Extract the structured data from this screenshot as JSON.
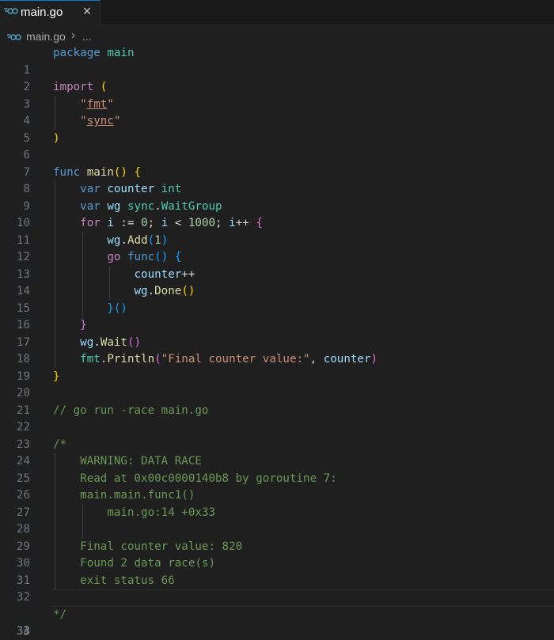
{
  "tab": {
    "label": "main.go",
    "close_icon": "×"
  },
  "breadcrumb": {
    "file": "main.go",
    "separator": "›",
    "more": "..."
  },
  "editor": {
    "line_numbers": [
      "1",
      "2",
      "3",
      "4",
      "5",
      "6",
      "7",
      "8",
      "9",
      "10",
      "11",
      "12",
      "13",
      "14",
      "15",
      "16",
      "17",
      "18",
      "19",
      "20",
      "21",
      "22",
      "23",
      "24",
      "25",
      "26",
      "27",
      "28",
      "29",
      "30",
      "31",
      "32",
      "33",
      "34"
    ],
    "active_line": 33,
    "code": {
      "l1_kw": "package",
      "l1_name": "main",
      "l3_kw": "import",
      "l3_paren": "(",
      "l4_q1": "\"",
      "l4_pkg": "fmt",
      "l4_q2": "\"",
      "l5_q1": "\"",
      "l5_pkg": "sync",
      "l5_q2": "\"",
      "l6_paren": ")",
      "l8_kw": "func",
      "l8_name": "main",
      "l8_parens": "()",
      "l8_brace": "{",
      "l9_kw": "var",
      "l9_name": "counter",
      "l9_type": "int",
      "l10_kw": "var",
      "l10_name": "wg",
      "l10_pkg": "sync",
      "l10_dot": ".",
      "l10_type": "WaitGroup",
      "l11_kw": "for",
      "l11_i": "i",
      "l11_op": " := ",
      "l11_zero": "0",
      "l11_semi1": "; ",
      "l11_i2": "i",
      "l11_lt": " < ",
      "l11_n": "1000",
      "l11_semi2": "; ",
      "l11_i3": "i",
      "l11_inc": "++",
      "l11_brace": "{",
      "l12_obj": "wg",
      "l12_dot": ".",
      "l12_fn": "Add",
      "l12_p1": "(",
      "l12_num": "1",
      "l12_p2": ")",
      "l13_kw": "go",
      "l13_fn": "func",
      "l13_parens": "()",
      "l13_brace": "{",
      "l14_var": "counter",
      "l14_op": "++",
      "l15_obj": "wg",
      "l15_dot": ".",
      "l15_fn": "Done",
      "l15_parens": "()",
      "l16_brace": "}",
      "l16_parens": "()",
      "l17_brace": "}",
      "l18_obj": "wg",
      "l18_dot": ".",
      "l18_fn": "Wait",
      "l18_parens": "()",
      "l19_pkg": "fmt",
      "l19_dot": ".",
      "l19_fn": "Println",
      "l19_p1": "(",
      "l19_str": "\"Final counter value:\"",
      "l19_comma": ", ",
      "l19_var": "counter",
      "l19_p2": ")",
      "l20_brace": "}",
      "l22_comment": "// go run -race main.go",
      "l24_comment": "/*",
      "l25_comment": "WARNING: DATA RACE",
      "l26_comment": "Read at 0x00c0000140b8 by goroutine 7:",
      "l27_comment": "main.main.func1()",
      "l28_comment": "main.go:14 +0x33",
      "l30_comment": "Final counter value: 820",
      "l31_comment": "Found 2 data race(s)",
      "l32_comment": "exit status 66",
      "l34_comment": "*/"
    }
  },
  "colors": {
    "background": "#1f1f1f",
    "keyword": "#569cd6",
    "control": "#c586c0",
    "function": "#dcdcaa",
    "variable": "#9cdcfe",
    "type": "#4ec9b0",
    "string": "#ce9178",
    "number": "#b5cea8",
    "comment": "#6a9955",
    "go_icon": "#519aba"
  }
}
